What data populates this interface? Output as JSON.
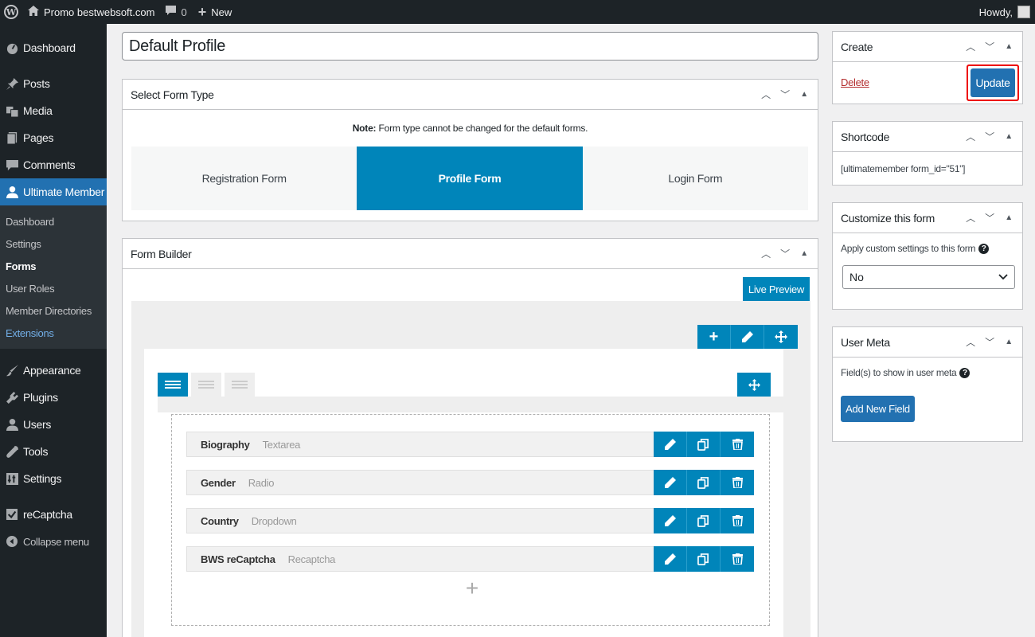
{
  "adminbar": {
    "site_name": "Promo bestwebsoft.com",
    "comments_count": "0",
    "new_label": "New",
    "howdy": "Howdy,"
  },
  "sidebar": {
    "items": [
      {
        "label": "Dashboard",
        "icon": "dashboard-icon"
      },
      {
        "label": "Posts",
        "icon": "pin-icon"
      },
      {
        "label": "Media",
        "icon": "media-icon"
      },
      {
        "label": "Pages",
        "icon": "pages-icon"
      },
      {
        "label": "Comments",
        "icon": "comment-icon"
      },
      {
        "label": "Ultimate Member",
        "icon": "user-icon"
      }
    ],
    "submenu": [
      "Dashboard",
      "Settings",
      "Forms",
      "User Roles",
      "Member Directories",
      "Extensions"
    ],
    "items2": [
      {
        "label": "Appearance",
        "icon": "brush-icon"
      },
      {
        "label": "Plugins",
        "icon": "plug-icon"
      },
      {
        "label": "Users",
        "icon": "users-icon"
      },
      {
        "label": "Tools",
        "icon": "wrench-icon"
      },
      {
        "label": "Settings",
        "icon": "settings-icon"
      },
      {
        "label": "reCaptcha",
        "icon": "check-icon"
      },
      {
        "label": "Collapse menu",
        "icon": "collapse-icon"
      }
    ]
  },
  "main": {
    "title_value": "Default Profile",
    "select_form_type": {
      "heading": "Select Form Type",
      "note_label": "Note:",
      "note_text": " Form type cannot be changed for the default forms.",
      "types": [
        "Registration Form",
        "Profile Form",
        "Login Form"
      ],
      "active_type": "Profile Form"
    },
    "form_builder": {
      "heading": "Form Builder",
      "live_preview": "Live Preview",
      "fields": [
        {
          "title": "Biography",
          "type": "Textarea"
        },
        {
          "title": "Gender",
          "type": "Radio"
        },
        {
          "title": "Country",
          "type": "Dropdown"
        },
        {
          "title": "BWS reCaptcha",
          "type": "Recaptcha"
        }
      ]
    }
  },
  "right": {
    "create": {
      "heading": "Create",
      "delete": "Delete",
      "update": "Update"
    },
    "shortcode": {
      "heading": "Shortcode",
      "value": "[ultimatemember form_id=\"51\"]"
    },
    "customize": {
      "heading": "Customize this form",
      "label": "Apply custom settings to this form",
      "selected": "No"
    },
    "user_meta": {
      "heading": "User Meta",
      "label": "Field(s) to show in user meta",
      "button": "Add New Field"
    }
  },
  "colors": {
    "accent": "#0085ba",
    "wp_blue": "#2271b1",
    "admin_dark": "#1d2327",
    "highlight_border": "#ee0000"
  }
}
